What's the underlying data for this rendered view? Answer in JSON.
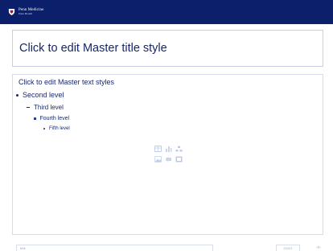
{
  "header": {
    "logo_line1": "Penn Medicine",
    "logo_line2": "Penn Health"
  },
  "title_placeholder": {
    "text": "Click to edit Master title style"
  },
  "body_placeholder": {
    "level1": "Click to edit Master text styles",
    "level2": "Second level",
    "level3": "Third level",
    "level4": "Fourth level",
    "level5": "Fifth level"
  },
  "content_icons": [
    {
      "name": "table-icon",
      "color": "#8fa6d8"
    },
    {
      "name": "chart-icon",
      "color": "#9fb3dc"
    },
    {
      "name": "smartart-icon",
      "color": "#8aa0cf"
    },
    {
      "name": "picture-icon",
      "color": "#8fa6d8"
    },
    {
      "name": "clipart-icon",
      "color": "#9fb3dc"
    },
    {
      "name": "media-icon",
      "color": "#8aa0cf"
    }
  ],
  "footer": {
    "text": "hfdr",
    "date": "2/10/1",
    "slide_number": "‹#›"
  },
  "colors": {
    "header_bg": "#0b1f6b",
    "text": "#1a2a6c",
    "border": "#c9d0e4"
  }
}
